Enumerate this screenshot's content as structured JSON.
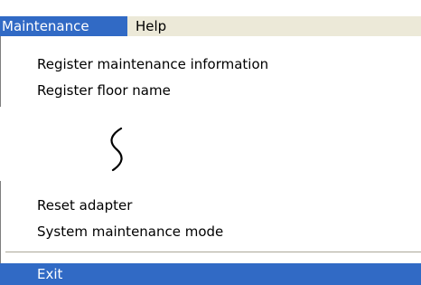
{
  "menubar": {
    "items": [
      {
        "label": "Maintenance"
      },
      {
        "label": "Help"
      }
    ]
  },
  "maintenance_menu": {
    "items": [
      {
        "label": "Register maintenance information"
      },
      {
        "label": "Register floor name"
      },
      {
        "label": "Reset adapter"
      },
      {
        "label": "System maintenance mode"
      },
      {
        "label": "Exit"
      }
    ],
    "omitted_indicator": "squiggle-break-icon"
  },
  "colors": {
    "highlight": "#316ac5",
    "menubar_bg": "#ece9d8",
    "separator": "#aca899"
  }
}
